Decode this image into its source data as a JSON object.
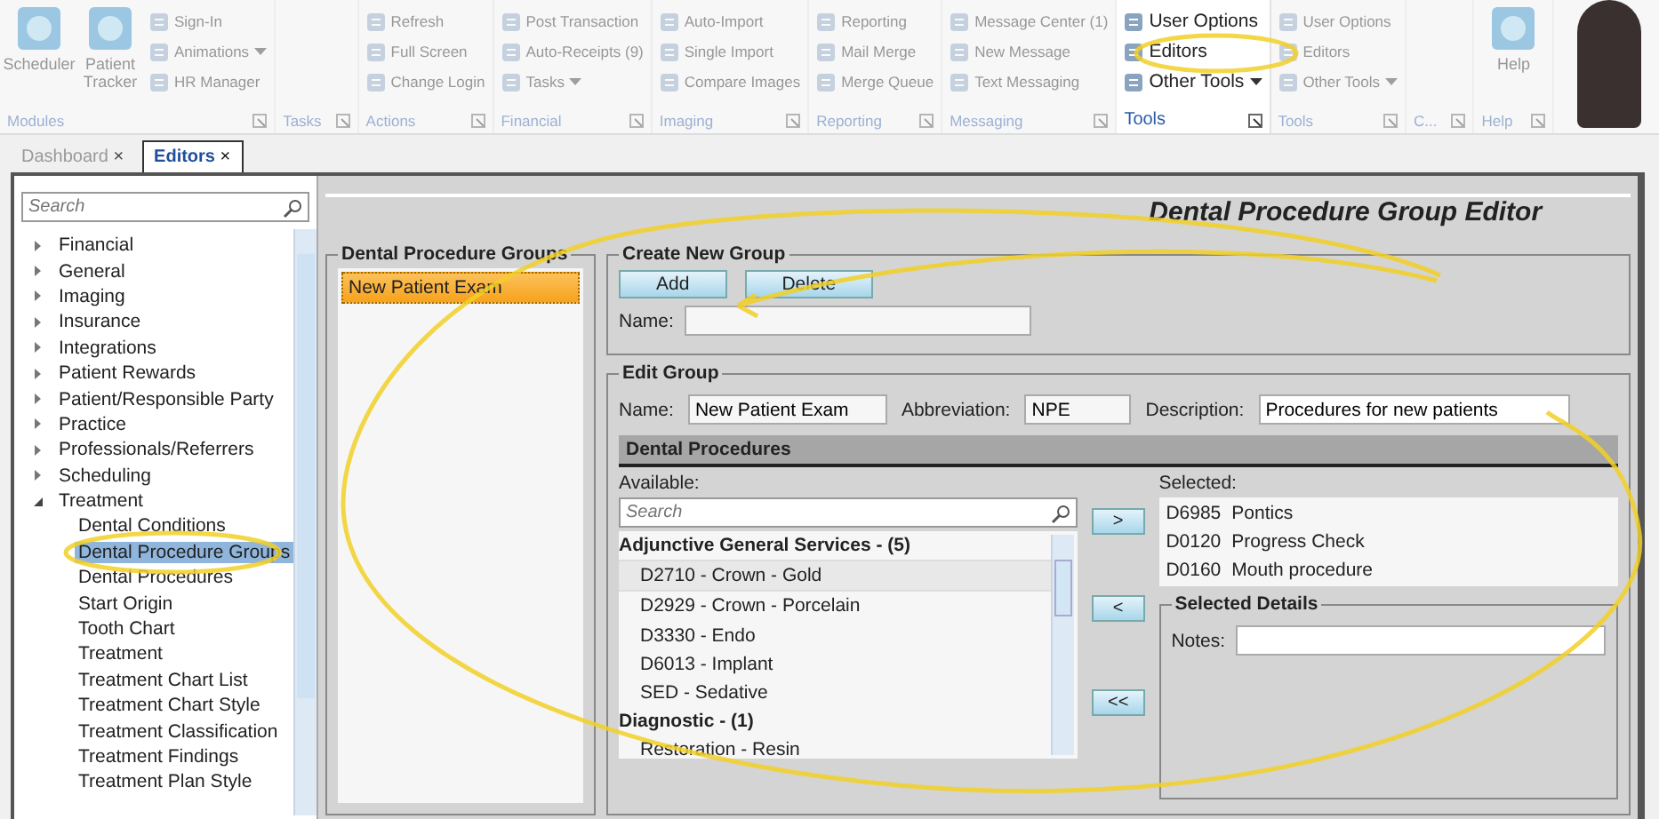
{
  "ribbon": {
    "groups": [
      {
        "label": "Modules",
        "focused": false,
        "large": [
          {
            "label": "Scheduler"
          },
          {
            "label": "Patient Tracker"
          }
        ],
        "small": [
          {
            "label": "Sign-In"
          },
          {
            "label": "Animations",
            "dropdown": true
          },
          {
            "label": "HR Manager"
          }
        ]
      },
      {
        "label": "Tasks",
        "focused": false
      },
      {
        "label": "Actions",
        "focused": false,
        "small": [
          {
            "label": "Refresh"
          },
          {
            "label": "Full Screen"
          },
          {
            "label": "Change Login"
          }
        ]
      },
      {
        "label": "Financial",
        "focused": false,
        "small": [
          {
            "label": "Post Transaction"
          },
          {
            "label": "Auto-Receipts (9)"
          },
          {
            "label": "Tasks",
            "dropdown": true
          }
        ]
      },
      {
        "label": "Imaging",
        "focused": false,
        "small": [
          {
            "label": "Auto-Import"
          },
          {
            "label": "Single Import"
          },
          {
            "label": "Compare Images"
          }
        ]
      },
      {
        "label": "Reporting",
        "focused": false,
        "small": [
          {
            "label": "Reporting"
          },
          {
            "label": "Mail Merge"
          },
          {
            "label": "Merge Queue"
          }
        ]
      },
      {
        "label": "Messaging",
        "focused": false,
        "small": [
          {
            "label": "Message Center (1)"
          },
          {
            "label": "New Message"
          },
          {
            "label": "Text Messaging"
          }
        ]
      },
      {
        "label": "Tools",
        "focused": true,
        "small": [
          {
            "label": "User Options"
          },
          {
            "label": "Editors"
          },
          {
            "label": "Other Tools",
            "dropdown": true
          }
        ]
      },
      {
        "label": "Tools",
        "focused": false,
        "small": [
          {
            "label": "User Options"
          },
          {
            "label": "Editors"
          },
          {
            "label": "Other Tools",
            "dropdown": true
          }
        ]
      },
      {
        "label": "C...",
        "focused": false
      },
      {
        "label": "Help",
        "focused": false,
        "large": [
          {
            "label": "Help"
          }
        ]
      }
    ]
  },
  "tabs": [
    {
      "label": "Dashboard",
      "close": "×",
      "selected": false
    },
    {
      "label": "Editors",
      "close": "×",
      "selected": true
    }
  ],
  "sidebar": {
    "search": {
      "placeholder": "Search"
    },
    "tree": [
      {
        "label": "Financial",
        "expanded": false,
        "selected": false
      },
      {
        "label": "General",
        "expanded": false,
        "selected": false
      },
      {
        "label": "Imaging",
        "expanded": false,
        "selected": false
      },
      {
        "label": "Insurance",
        "expanded": false,
        "selected": false
      },
      {
        "label": "Integrations",
        "expanded": false,
        "selected": false
      },
      {
        "label": "Patient Rewards",
        "expanded": false,
        "selected": false
      },
      {
        "label": "Patient/Responsible Party",
        "expanded": false,
        "selected": false
      },
      {
        "label": "Practice",
        "expanded": false,
        "selected": false
      },
      {
        "label": "Professionals/Referrers",
        "expanded": false,
        "selected": false
      },
      {
        "label": "Scheduling",
        "expanded": false,
        "selected": false
      },
      {
        "label": "Treatment",
        "expanded": true,
        "selected": false,
        "children": [
          {
            "label": "Dental Conditions",
            "selected": false
          },
          {
            "label": "Dental Procedure Groups",
            "selected": true
          },
          {
            "label": "Dental Procedures",
            "selected": false
          },
          {
            "label": "Start Origin",
            "selected": false
          },
          {
            "label": "Tooth Chart",
            "selected": false
          },
          {
            "label": "Treatment",
            "selected": false
          },
          {
            "label": "Treatment Chart List",
            "selected": false
          },
          {
            "label": "Treatment Chart Style",
            "selected": false
          },
          {
            "label": "Treatment Classification",
            "selected": false
          },
          {
            "label": "Treatment Findings",
            "selected": false
          },
          {
            "label": "Treatment Plan Style",
            "selected": false
          }
        ]
      }
    ]
  },
  "editor": {
    "title": "Dental Procedure Group Editor",
    "groups_list": {
      "title": "Dental Procedure Groups",
      "items": [
        {
          "label": "New Patient Exam",
          "selected": true
        }
      ]
    },
    "create_group": {
      "legend": "Create New Group",
      "buttons": [
        "Add",
        "Delete"
      ],
      "name_label": "Name:"
    },
    "edit_group": {
      "legend": "Edit Group",
      "fields": [
        {
          "label": "Name:",
          "value": "New Patient Exam"
        },
        {
          "label": "Abbreviation:",
          "value": "NPE"
        },
        {
          "label": "Description:",
          "value": "Procedures for new patients"
        }
      ],
      "procedures": {
        "title": "Dental Procedures",
        "available_label": "Available:",
        "search_placeholder": "Search",
        "categories": [
          {
            "label": "Adjunctive General Services - (5)",
            "items": [
              {
                "label": "D2710 - Crown - Gold",
                "selected": true
              },
              {
                "label": "D2929 - Crown - Porcelain",
                "selected": false
              },
              {
                "label": "D3330 - Endo",
                "selected": false
              },
              {
                "label": "D6013 - Implant",
                "selected": false
              },
              {
                "label": "SED - Sedative",
                "selected": false
              }
            ]
          },
          {
            "label": "Diagnostic - (1)",
            "items": [
              {
                "label": "Restoration - Resin",
                "selected": false
              }
            ]
          }
        ],
        "move_buttons": [
          ">",
          "<",
          "<<"
        ],
        "selected_label": "Selected:",
        "selected_items": [
          {
            "code": "D6985",
            "name": "Pontics"
          },
          {
            "code": "D0120",
            "name": "Progress Check"
          },
          {
            "code": "D0160",
            "name": "Mouth procedure"
          }
        ],
        "details": {
          "legend": "Selected Details",
          "notes_label": "Notes:"
        }
      }
    }
  }
}
